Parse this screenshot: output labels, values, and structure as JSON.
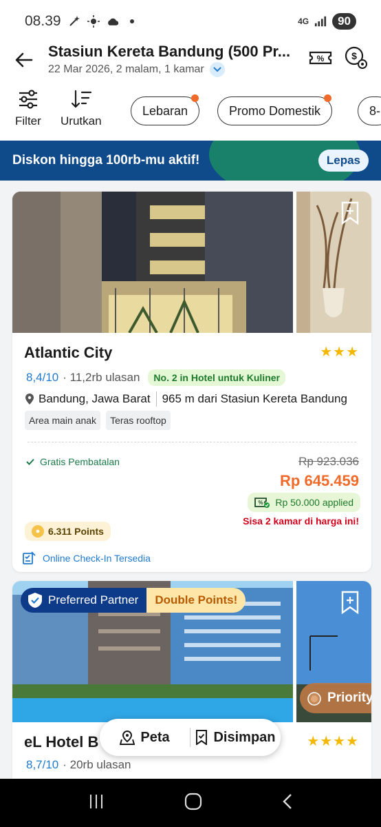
{
  "status_bar": {
    "time": "08.39",
    "network": "4G",
    "battery": "90"
  },
  "header": {
    "title": "Stasiun Kereta Bandung (500 Pr...",
    "subtitle": "22 Mar 2026, 2 malam, 1 kamar"
  },
  "toolbar": {
    "filter_label": "Filter",
    "sort_label": "Urutkan"
  },
  "chips": [
    "Lebaran",
    "Promo Domestik",
    "8-"
  ],
  "promo": {
    "text": "Diskon hingga 100rb-mu aktif!",
    "button": "Lepas"
  },
  "hotels": [
    {
      "name": "Atlantic City",
      "stars": "★★★",
      "rating": "8,4/10",
      "reviews": "· 11,2rb ulasan",
      "rank": "No. 2 in Hotel untuk Kuliner",
      "location": "Bandung, Jawa Barat",
      "distance": "965 m dari Stasiun Kereta Bandung",
      "tags": [
        "Area main anak",
        "Teras rooftop"
      ],
      "cancellation": "Gratis Pembatalan",
      "old_price": "Rp 923.036",
      "price": "Rp 645.459",
      "applied": "Rp 50.000 applied",
      "rooms_left": "Sisa 2 kamar di harga ini!",
      "points": "6.311 Points",
      "checkin": "Online Check-In Tersedia"
    },
    {
      "name": "eL Hotel B",
      "stars": "★★★★",
      "rating": "8,7/10",
      "reviews": "· 20rb ulasan",
      "badge_partner": "Preferred Partner",
      "badge_points": "Double Points!",
      "badge_priority": "Priority"
    }
  ],
  "fab": {
    "map_label": "Peta",
    "saved_label": "Disimpan"
  },
  "colors": {
    "accent_orange": "#f06a2a",
    "rating_blue": "#1f7ad1",
    "brand_navy": "#0e3a8a",
    "star": "#f5b800"
  }
}
